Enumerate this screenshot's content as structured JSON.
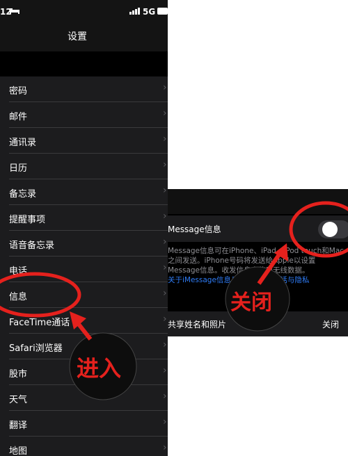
{
  "left_screen": {
    "status": {
      "time": "12",
      "network": "5G"
    },
    "nav_title": "设置",
    "items": [
      {
        "label": "密码"
      },
      {
        "label": "邮件"
      },
      {
        "label": "通讯录"
      },
      {
        "label": "日历"
      },
      {
        "label": "备忘录"
      },
      {
        "label": "提醒事项"
      },
      {
        "label": "语音备忘录"
      },
      {
        "label": "电话"
      },
      {
        "label": "信息"
      },
      {
        "label": "FaceTime通话"
      },
      {
        "label": "Safari浏览器"
      },
      {
        "label": "股市"
      },
      {
        "label": "天气"
      },
      {
        "label": "翻译"
      },
      {
        "label": "地图"
      }
    ]
  },
  "right_screen": {
    "imessage_label": "Message信息",
    "imessage_toggle": "off",
    "desc_line1": "Message信息可在iPhone、iPad、iPod touch和Mac",
    "desc_line2": "之间发送。iPhone号码将发送给Apple以设置",
    "desc_line3": "Message信息。收发信息会使用无线数据。",
    "desc_link": "关于iMessage信息与FaceTime通话与隐私",
    "share_label": "共享姓名和照片",
    "share_value": "关闭"
  },
  "annotations": {
    "enter": "进入",
    "close": "关闭",
    "color": "#e5211d"
  }
}
